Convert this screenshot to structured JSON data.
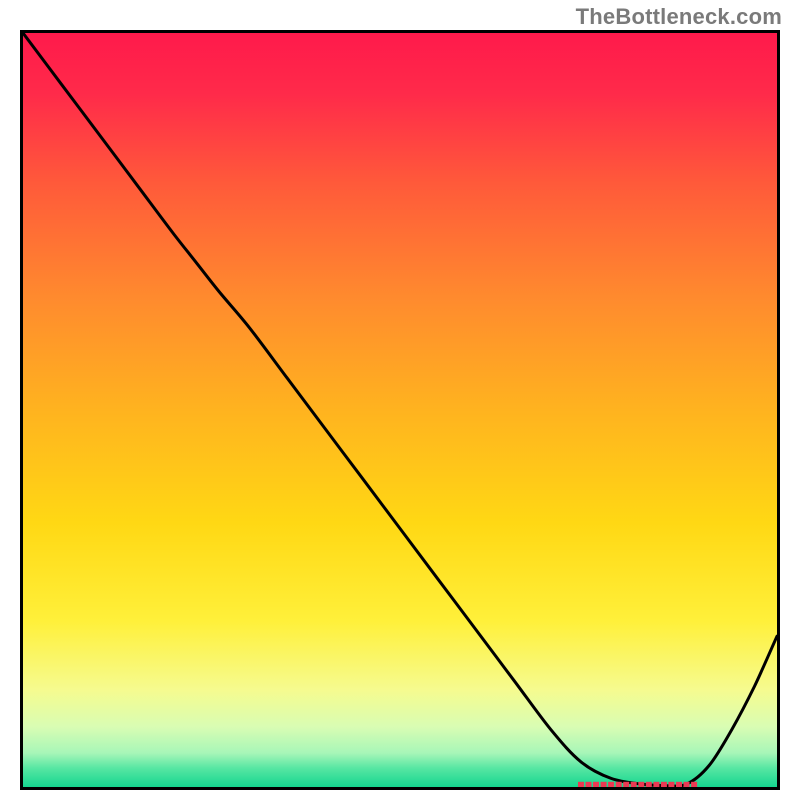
{
  "watermark": "TheBottleneck.com",
  "chart_data": {
    "type": "line",
    "title": "",
    "xlabel": "",
    "ylabel": "",
    "xlim": [
      0,
      100
    ],
    "ylim": [
      0,
      105
    ],
    "grid": false,
    "legend": false,
    "series": [
      {
        "name": "curve",
        "x": [
          0,
          5,
          10,
          15,
          20,
          23,
          26,
          30,
          35,
          40,
          45,
          50,
          55,
          60,
          65,
          70,
          74,
          78,
          82,
          85,
          88,
          91,
          94,
          97,
          100
        ],
        "y": [
          105,
          98,
          91,
          84,
          77,
          73,
          69,
          64,
          57,
          50,
          43,
          36,
          29,
          22,
          15,
          8,
          3.5,
          1.2,
          0.4,
          0.2,
          0.4,
          3,
          8,
          14,
          21
        ]
      }
    ],
    "highlight": {
      "name": "bottleneck-region",
      "x_start": 74,
      "x_end": 89,
      "y": 0.3
    },
    "gradient_stops": [
      {
        "offset": 0.0,
        "color": "#ff1a4b"
      },
      {
        "offset": 0.08,
        "color": "#ff2a4a"
      },
      {
        "offset": 0.2,
        "color": "#ff5a3a"
      },
      {
        "offset": 0.35,
        "color": "#ff8a2e"
      },
      {
        "offset": 0.5,
        "color": "#ffb31f"
      },
      {
        "offset": 0.65,
        "color": "#ffd814"
      },
      {
        "offset": 0.78,
        "color": "#fff03a"
      },
      {
        "offset": 0.87,
        "color": "#f6fb8e"
      },
      {
        "offset": 0.92,
        "color": "#d9fdb3"
      },
      {
        "offset": 0.955,
        "color": "#a7f6b8"
      },
      {
        "offset": 0.975,
        "color": "#57e6a3"
      },
      {
        "offset": 1.0,
        "color": "#15d68f"
      }
    ]
  }
}
